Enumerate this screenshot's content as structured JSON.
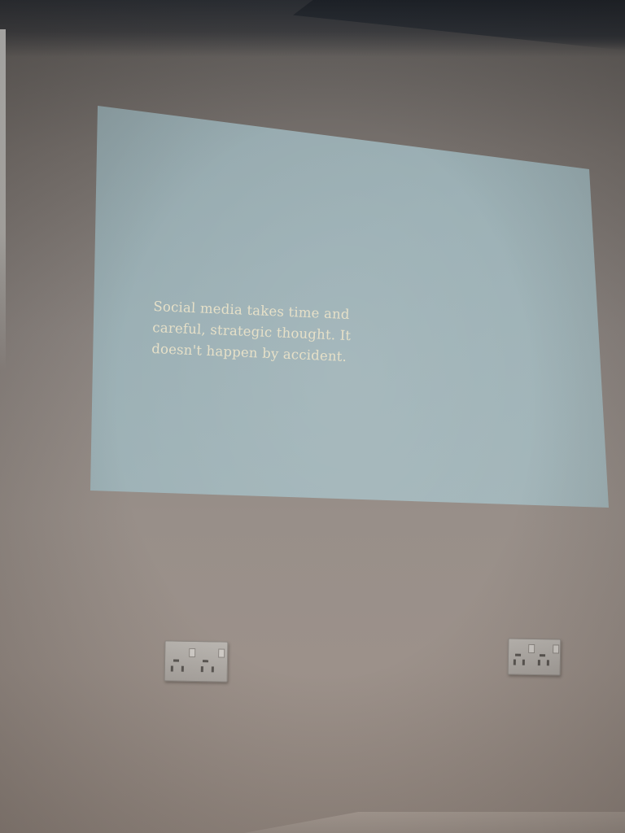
{
  "slide": {
    "lines": [
      "Social media takes time and",
      "careful, strategic thought. It",
      "doesn't happen by accident."
    ]
  },
  "colors": {
    "wall": "#988f89",
    "screen": "#99aeb3",
    "slide_text": "#e6e0c8",
    "ceiling": "#2a2e34"
  },
  "icons": [
    "power-socket-icon"
  ]
}
